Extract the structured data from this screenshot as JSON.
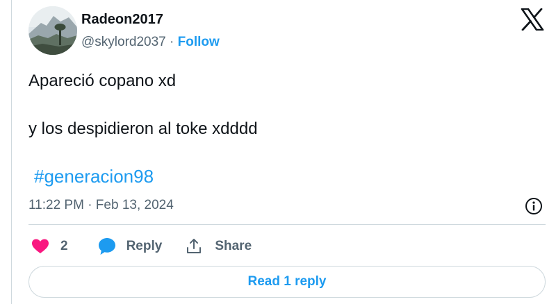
{
  "author": {
    "display_name": "Radeon2017",
    "handle": "@skylord2037",
    "separator": " · ",
    "follow_label": "Follow"
  },
  "post": {
    "line1": "Apareció copano xd",
    "line2": "y los despidieron al toke xdddd",
    "hashtag": "#generacion98",
    "timestamp": "11:22 PM · Feb 13, 2024"
  },
  "actions": {
    "like_count": "2",
    "reply_label": "Reply",
    "share_label": "Share"
  },
  "read_replies_label": "Read 1 reply",
  "icons": {
    "logo": "x-logo-icon",
    "info": "info-icon",
    "like": "heart-icon",
    "reply": "chat-bubble-icon",
    "share": "share-upload-icon"
  },
  "colors": {
    "accent": "#1d9bf0",
    "like": "#f91880",
    "text": "#0f1419",
    "muted": "#536471",
    "border": "#cfd9de"
  }
}
